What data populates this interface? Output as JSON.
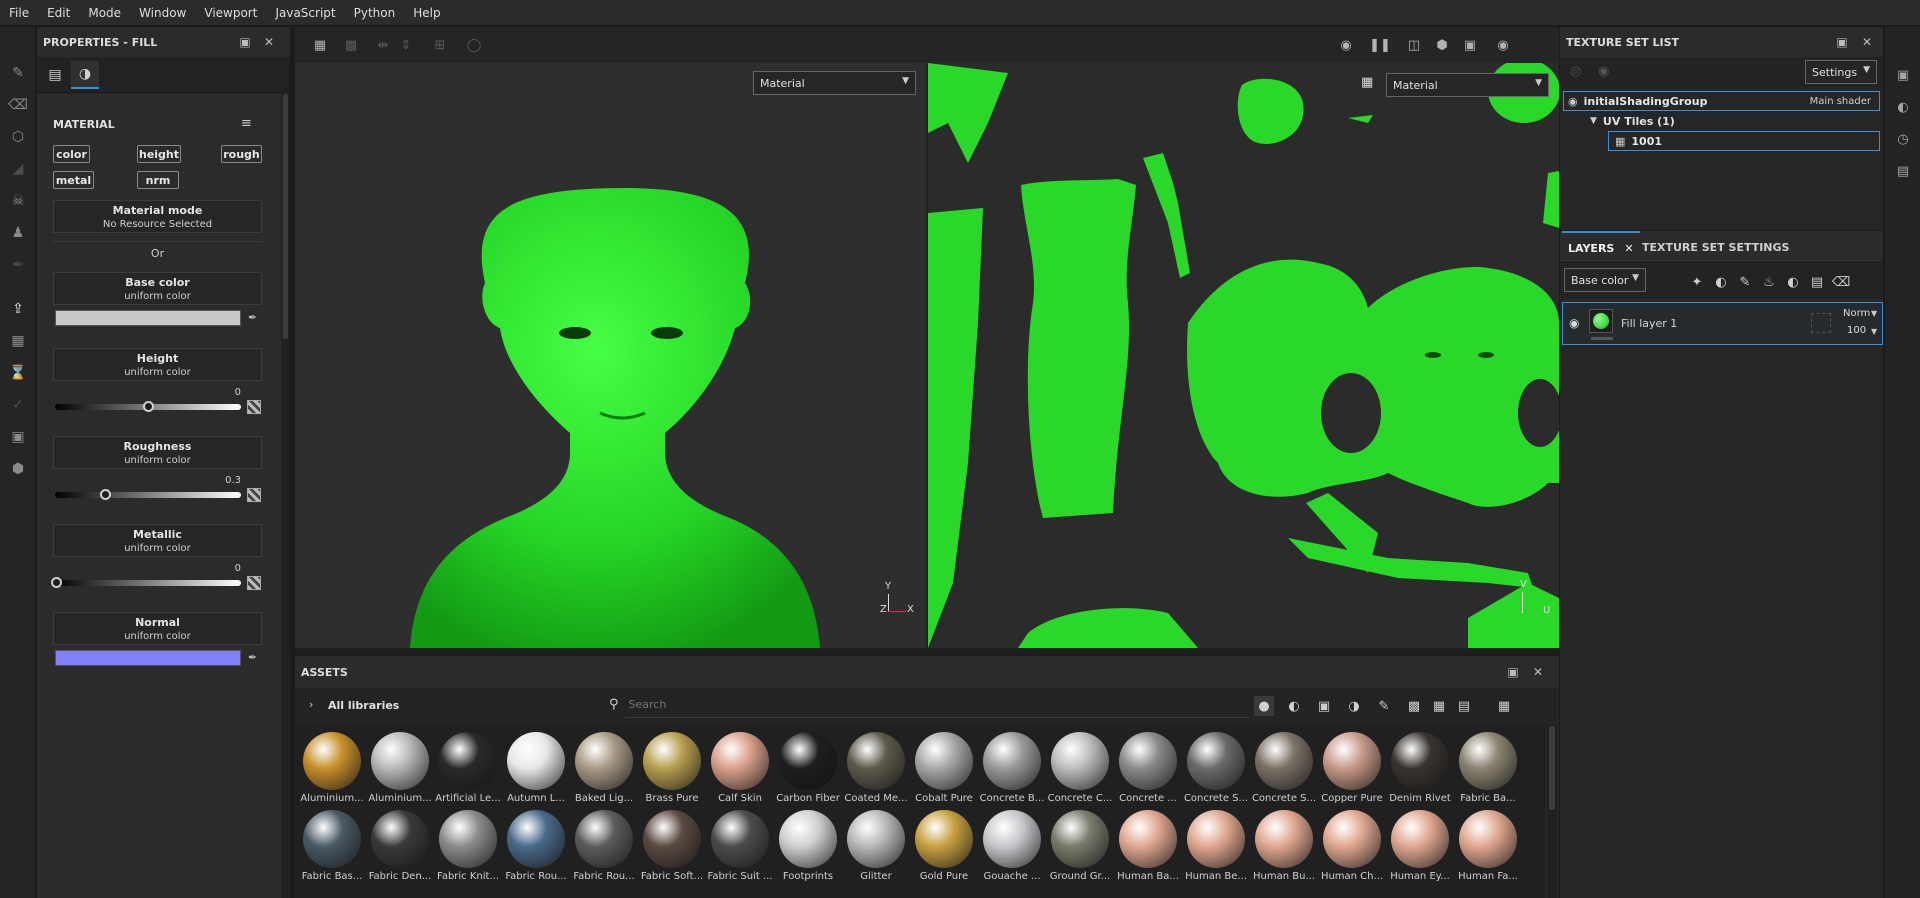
{
  "menu": [
    "File",
    "Edit",
    "Mode",
    "Window",
    "Viewport",
    "JavaScript",
    "Python",
    "Help"
  ],
  "properties": {
    "title": "PROPERTIES - FILL",
    "section": "MATERIAL",
    "channels": [
      "color",
      "height",
      "rough",
      "metal",
      "nrm"
    ],
    "material_mode": {
      "label": "Material mode",
      "value": "No Resource Selected"
    },
    "or_label": "Or",
    "base_color": {
      "label": "Base color",
      "sub": "uniform color",
      "color": "#c8c8c8"
    },
    "height": {
      "label": "Height",
      "sub": "uniform color",
      "value": "0"
    },
    "roughness": {
      "label": "Roughness",
      "sub": "uniform color",
      "value": "0.3"
    },
    "metallic": {
      "label": "Metallic",
      "sub": "uniform color",
      "value": "0"
    },
    "normal": {
      "label": "Normal",
      "sub": "uniform color",
      "color": "#8080ff"
    }
  },
  "viewport": {
    "left_mode": "Material",
    "right_mode": "Material",
    "axis_3d": {
      "y": "Y",
      "x": "X",
      "z": "Z"
    },
    "axis_uv": {
      "v": "V",
      "u": "U"
    },
    "mesh_color": "#2fe02f"
  },
  "texture_set_list": {
    "title": "TEXTURE SET LIST",
    "settings_label": "Settings",
    "set_name": "initialShadingGroup",
    "shader": "Main shader",
    "uv_tiles": "UV Tiles (1)",
    "tile": "1001"
  },
  "layers": {
    "tab_layers": "LAYERS",
    "tab_settings": "TEXTURE SET SETTINGS",
    "channel": "Base color",
    "layer_name": "Fill layer 1",
    "blend_mode": "Norm",
    "opacity": "100"
  },
  "assets": {
    "title": "ASSETS",
    "libraries": "All libraries",
    "search_placeholder": "Search",
    "row1": [
      {
        "name": "Aluminium...",
        "color": "#c8902a"
      },
      {
        "name": "Aluminium...",
        "color": "#b8b8b8"
      },
      {
        "name": "Artificial Le...",
        "color": "#2a2a2a"
      },
      {
        "name": "Autumn L...",
        "color": "#e8e8e8"
      },
      {
        "name": "Baked Lig...",
        "color": "#a99a86"
      },
      {
        "name": "Brass Pure",
        "color": "#b8a050"
      },
      {
        "name": "Calf Skin",
        "color": "#d9a08a"
      },
      {
        "name": "Carbon Fiber",
        "color": "#1e1e1e"
      },
      {
        "name": "Coated Me...",
        "color": "#5e5a4c"
      },
      {
        "name": "Cobalt Pure",
        "color": "#a8a8aa"
      },
      {
        "name": "Concrete B...",
        "color": "#9a9a9a"
      },
      {
        "name": "Concrete C...",
        "color": "#bdbdbd"
      },
      {
        "name": "Concrete ...",
        "color": "#8a8a8a"
      },
      {
        "name": "Concrete S...",
        "color": "#6a6a6a"
      },
      {
        "name": "Concrete S...",
        "color": "#7a7266"
      },
      {
        "name": "Copper Pure",
        "color": "#c89a88"
      },
      {
        "name": "Denim Rivet",
        "color": "#3a3430"
      },
      {
        "name": "Fabric Ba...",
        "color": "#8a8470"
      }
    ],
    "row2": [
      {
        "name": "Fabric Bas...",
        "color": "#4a5a66"
      },
      {
        "name": "Fabric Den...",
        "color": "#3a3a3c"
      },
      {
        "name": "Fabric Knit...",
        "color": "#8c8c8c"
      },
      {
        "name": "Fabric Rou...",
        "color": "#4a6a8a"
      },
      {
        "name": "Fabric Rou...",
        "color": "#5c5c5c"
      },
      {
        "name": "Fabric Soft...",
        "color": "#5a4a42"
      },
      {
        "name": "Fabric Suit ...",
        "color": "#4c4c4c"
      },
      {
        "name": "Footprints",
        "color": "#d0d0d0"
      },
      {
        "name": "Glitter",
        "color": "#b8b8b8"
      },
      {
        "name": "Gold Pure",
        "color": "#c8a040"
      },
      {
        "name": "Gouache ...",
        "color": "#c8c8cc"
      },
      {
        "name": "Ground Gr...",
        "color": "#7a7a6c"
      },
      {
        "name": "Human Ba...",
        "color": "#e0a890"
      },
      {
        "name": "Human Be...",
        "color": "#e0a890"
      },
      {
        "name": "Human Bu...",
        "color": "#e0a890"
      },
      {
        "name": "Human Ch...",
        "color": "#e0a890"
      },
      {
        "name": "Human Ey...",
        "color": "#e0a890"
      },
      {
        "name": "Human Fa...",
        "color": "#e0a890"
      }
    ]
  }
}
